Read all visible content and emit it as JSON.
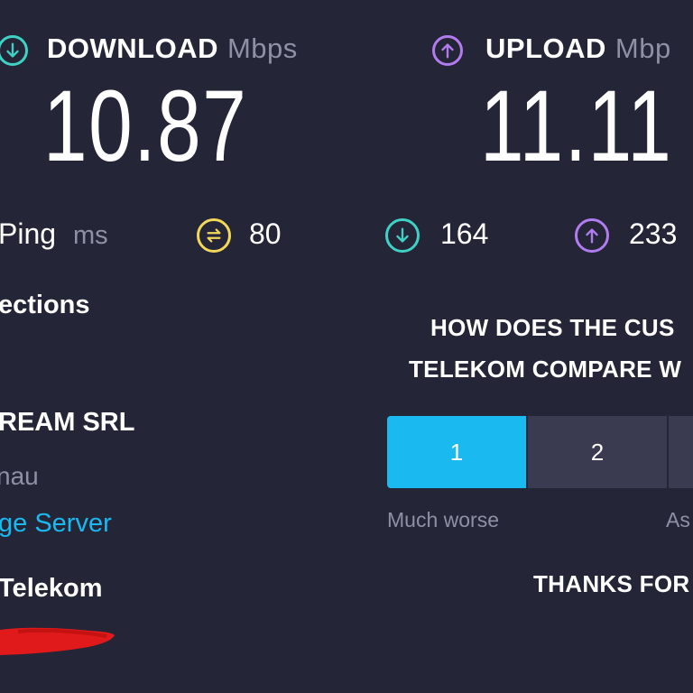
{
  "download": {
    "label": "DOWNLOAD",
    "unit": "Mbps",
    "value": "10.87",
    "color": "#3fd1c5"
  },
  "upload": {
    "label": "UPLOAD",
    "unit": "Mbp",
    "value": "11.11",
    "color": "#b07cf0"
  },
  "ping": {
    "label": "Ping",
    "unit": "ms",
    "idle_value": "80",
    "download_value": "164",
    "upload_value": "233",
    "idle_color": "#f1d85a"
  },
  "connections": {
    "heading": "ections",
    "provider": "REAM SRL",
    "location": "nau",
    "change_server": "ge Server",
    "isp": "Telekom"
  },
  "survey": {
    "question_line1": "HOW DOES THE CUS",
    "question_line2": "TELEKOM COMPARE W",
    "options": [
      "1",
      "2"
    ],
    "selected": "1",
    "label_low": "Much worse",
    "label_mid": "As",
    "thanks": "THANKS FOR"
  },
  "colors": {
    "background": "#242536",
    "accent_blue": "#1ab9f0",
    "link": "#1ab9f0",
    "redaction": "#e01a1a"
  }
}
